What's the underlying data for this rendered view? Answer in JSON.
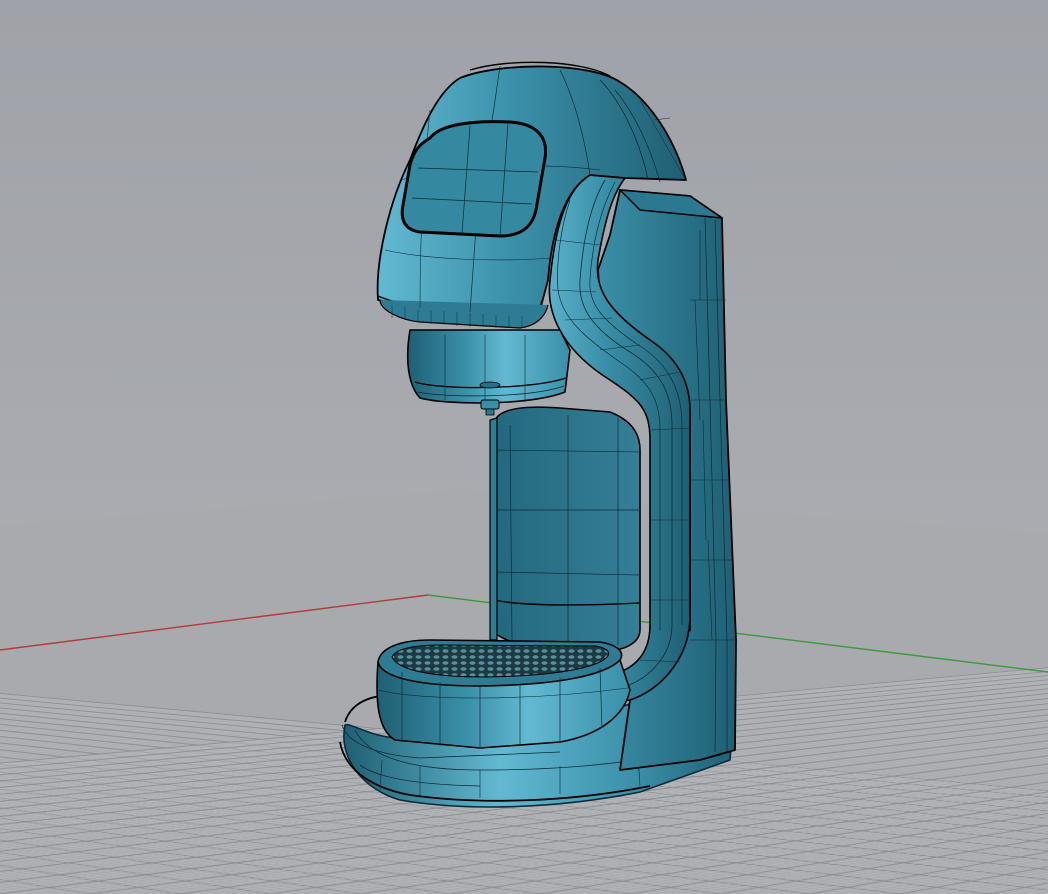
{
  "viewport": {
    "projection": "perspective",
    "display_mode": "shaded-with-isocurves",
    "background_top": "#9fa2a8",
    "background_horizon": "#a9abb0",
    "ground_color": "#a8aaae"
  },
  "grid": {
    "minor_line_color": "#b4b6ba",
    "major_line_color": "#8e9095"
  },
  "axes": {
    "x_axis_color": "#b23a3a",
    "y_axis_color": "#3c9a3c"
  },
  "model": {
    "surface_color": "#3a8fa8",
    "surface_highlight": "#63b9d1",
    "surface_shadow": "#1f5f73",
    "isocurve_color": "#0c2b36",
    "edge_color": "#000000"
  }
}
